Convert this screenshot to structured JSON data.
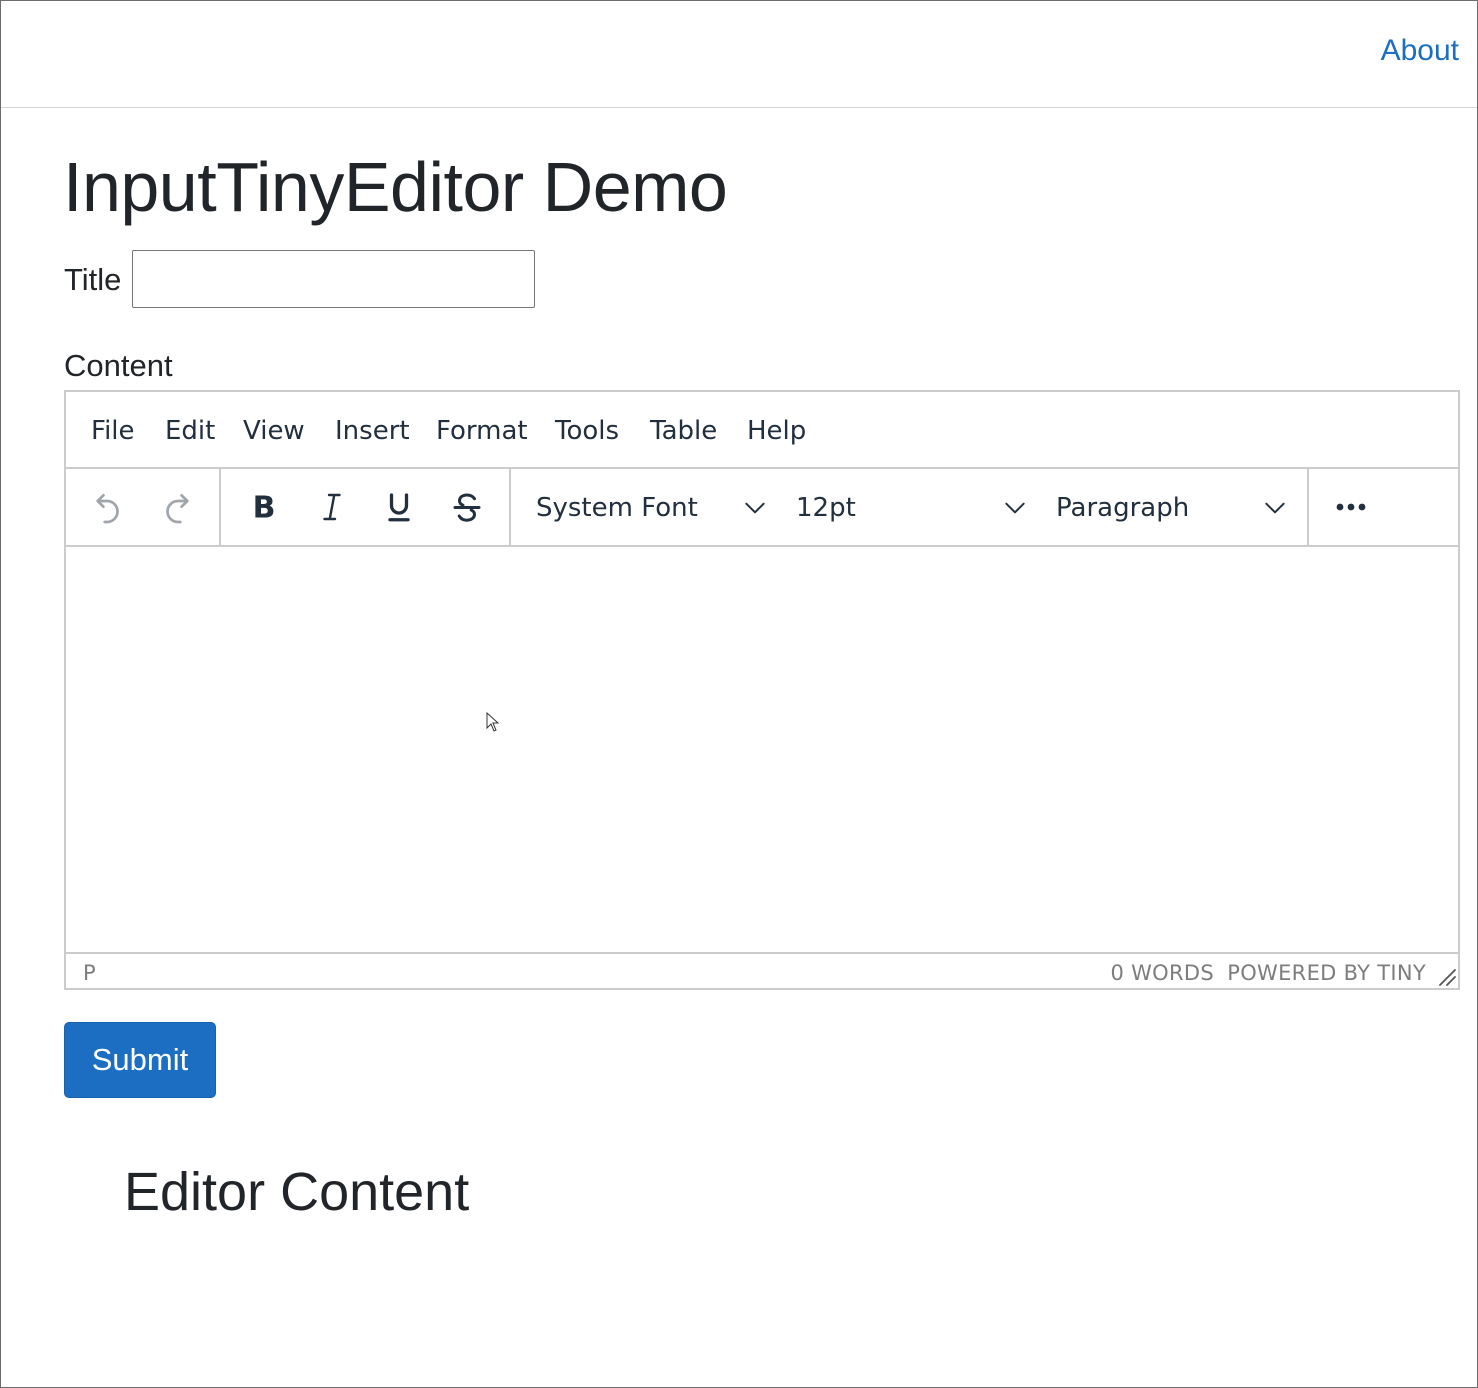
{
  "nav": {
    "about_label": "About"
  },
  "page": {
    "title": "InputTinyEditor Demo"
  },
  "form": {
    "title_label": "Title",
    "title_value": "",
    "content_label": "Content",
    "submit_label": "Submit"
  },
  "editor": {
    "menus": [
      "File",
      "Edit",
      "View",
      "Insert",
      "Format",
      "Tools",
      "Table",
      "Help"
    ],
    "toolbar": {
      "history": [
        "undo-icon",
        "redo-icon"
      ],
      "formatting": [
        "bold-icon",
        "italic-icon",
        "underline-icon",
        "strikethrough-icon"
      ],
      "font_family": "System Font",
      "font_size": "12pt",
      "block_format": "Paragraph",
      "more": "more-icon"
    },
    "statusbar": {
      "path": "P",
      "wordcount": "0 WORDS",
      "branding": "POWERED BY TINY"
    }
  },
  "output": {
    "heading": "Editor Content"
  },
  "colors": {
    "accent": "#1b6ec2",
    "text": "#212529",
    "editor_text": "#222f3e",
    "editor_border": "#cccccc",
    "status_text": "#7d7d7d"
  }
}
